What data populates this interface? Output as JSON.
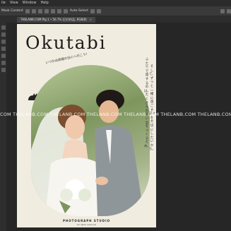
{
  "menubar": {
    "items": [
      "ile",
      "View",
      "Window",
      "Help"
    ]
  },
  "options": {
    "mode_label": "Mask Content",
    "toggle_label": "Auto-Select",
    "show_label": "Show Transform Controls"
  },
  "tab": {
    "label": "THELANB.COM Plg 1 • 50.7% (日付作品, RGB/8)",
    "close": "×"
  },
  "poster": {
    "title": "Okutabi",
    "subtitle": "いつかは結婚の日にへ行こう!",
    "vertical_1": "ふたりで旅するのは、たくさんの思い出をつくるため。",
    "vertical_2": "そして、ずっと一緒に過ごす日々を大切にしたいから。",
    "brand": "PHOTOGRAPH STUDIO",
    "brand_sub": "All rights reserved"
  },
  "watermark": {
    "text": "COM THELANB.COM THELANB.COM THELANB.COM THELANB.COM THELANB.COM THELANB.COM"
  },
  "colors": {
    "paper": "#f1ece0",
    "ui_dark": "#2b2b2b",
    "accent": "#1c1c1c"
  }
}
